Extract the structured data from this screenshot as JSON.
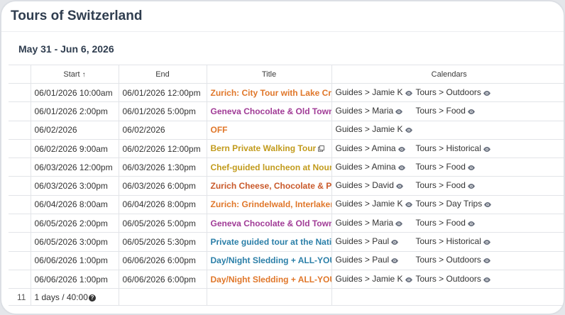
{
  "page": {
    "title": "Tours of Switzerland",
    "date_range": "May 31 - Jun 6, 2026"
  },
  "table": {
    "columns": [
      "",
      "Start",
      "End",
      "Title",
      "Calendars"
    ],
    "sort_indicator": "↑",
    "rows": [
      {
        "start": "06/01/2026 10:00am",
        "end": "06/01/2026 12:00pm",
        "title": "Zurich: City Tour with Lake Cruise",
        "title_color": "#e0772a",
        "cal_guide": "Guides > Jamie K",
        "cal_tour": "Tours > Outdoors",
        "external": false
      },
      {
        "start": "06/01/2026 2:00pm",
        "end": "06/01/2026 5:00pm",
        "title": "Geneva Chocolate & Old Town Tour",
        "title_color": "#a03b96",
        "cal_guide": "Guides > Maria",
        "cal_tour": "Tours > Food",
        "external": false
      },
      {
        "start": "06/02/2026",
        "end": "06/02/2026",
        "title": "OFF",
        "title_color": "#e0772a",
        "cal_guide": "Guides > Jamie K",
        "cal_tour": "",
        "external": false
      },
      {
        "start": "06/02/2026 9:00am",
        "end": "06/02/2026 12:00pm",
        "title": "Bern Private Walking Tour",
        "title_color": "#c29b1c",
        "cal_guide": "Guides > Amina",
        "cal_tour": "Tours > Historical",
        "external": true
      },
      {
        "start": "06/03/2026 12:00pm",
        "end": "06/03/2026 1:30pm",
        "title": "Chef-guided luncheon at Noumatrouff",
        "title_color": "#c29b1c",
        "cal_guide": "Guides > Amina",
        "cal_tour": "Tours > Food",
        "external": false
      },
      {
        "start": "06/03/2026 3:00pm",
        "end": "06/03/2026 6:00pm",
        "title": "Zurich Cheese, Chocolate & Pastry Tour",
        "title_color": "#c9592a",
        "cal_guide": "Guides > David",
        "cal_tour": "Tours > Food",
        "external": false
      },
      {
        "start": "06/04/2026 8:00am",
        "end": "06/04/2026 8:00pm",
        "title": "Zurich: Grindelwald, Interlaken Day Trip",
        "title_color": "#e0772a",
        "cal_guide": "Guides > Jamie K",
        "cal_tour": "Tours > Day Trips",
        "external": false
      },
      {
        "start": "06/05/2026 2:00pm",
        "end": "06/05/2026 5:00pm",
        "title": "Geneva Chocolate & Old Town Tour",
        "title_color": "#a03b96",
        "cal_guide": "Guides > Maria",
        "cal_tour": "Tours > Food",
        "external": false
      },
      {
        "start": "06/05/2026 3:00pm",
        "end": "06/05/2026 5:30pm",
        "title": "Private guided tour at the National Museum",
        "title_color": "#2b7fa8",
        "cal_guide": "Guides > Paul",
        "cal_tour": "Tours > Historical",
        "external": false
      },
      {
        "start": "06/06/2026 1:00pm",
        "end": "06/06/2026 6:00pm",
        "title": "Day/Night Sledding + ALL-YOU-CAN-EAT",
        "title_color": "#2b7fa8",
        "cal_guide": "Guides > Paul",
        "cal_tour": "Tours > Outdoors",
        "external": false
      },
      {
        "start": "06/06/2026 1:00pm",
        "end": "06/06/2026 6:00pm",
        "title": "Day/Night Sledding + ALL-YOU-CAN-EAT",
        "title_color": "#e0772a",
        "cal_guide": "Guides > Jamie K",
        "cal_tour": "Tours > Outdoors",
        "external": false
      }
    ],
    "footer": {
      "count": "11",
      "summary": "1 days / 40:00",
      "help_glyph": "?"
    }
  },
  "icons": {
    "visibility": "eye-icon",
    "external": "external-link-icon",
    "help": "help-icon"
  }
}
